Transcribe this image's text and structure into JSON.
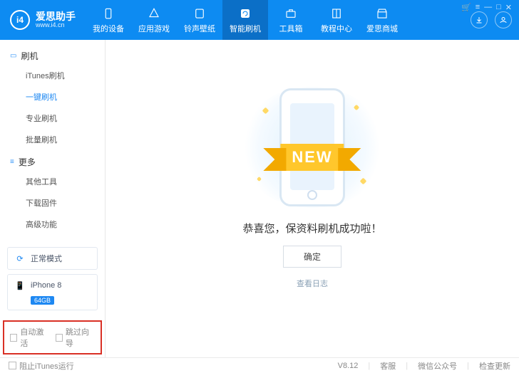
{
  "brand": {
    "name": "爱思助手",
    "url": "www.i4.cn",
    "badge": "i4"
  },
  "win": {
    "cart": "🛒",
    "menu": "≡",
    "min": "—",
    "max": "□",
    "close": "✕"
  },
  "nav": [
    {
      "label": "我的设备",
      "icon": "phone-icon"
    },
    {
      "label": "应用游戏",
      "icon": "apps-icon"
    },
    {
      "label": "铃声壁纸",
      "icon": "music-icon"
    },
    {
      "label": "智能刷机",
      "icon": "refresh-icon",
      "active": true
    },
    {
      "label": "工具箱",
      "icon": "toolbox-icon"
    },
    {
      "label": "教程中心",
      "icon": "book-icon"
    },
    {
      "label": "爱思商城",
      "icon": "store-icon"
    }
  ],
  "sidebar": {
    "group1": {
      "title": "刷机"
    },
    "links1": [
      "iTunes刷机",
      "一键刷机",
      "专业刷机",
      "批量刷机"
    ],
    "active_index": 1,
    "group2": {
      "title": "更多"
    },
    "links2": [
      "其他工具",
      "下载固件",
      "高级功能"
    ],
    "mode": {
      "label": "正常模式"
    },
    "device": {
      "name": "iPhone 8",
      "storage": "64GB"
    },
    "checks": {
      "auto_activate": "自动激活",
      "skip_guide": "跳过向导"
    }
  },
  "main": {
    "ribbon_text": "NEW",
    "success": "恭喜您，保资料刷机成功啦！",
    "ok": "确定",
    "log": "查看日志"
  },
  "footer": {
    "block_itunes": "阻止iTunes运行",
    "version": "V8.12",
    "support": "客服",
    "wechat": "微信公众号",
    "update": "检查更新"
  }
}
